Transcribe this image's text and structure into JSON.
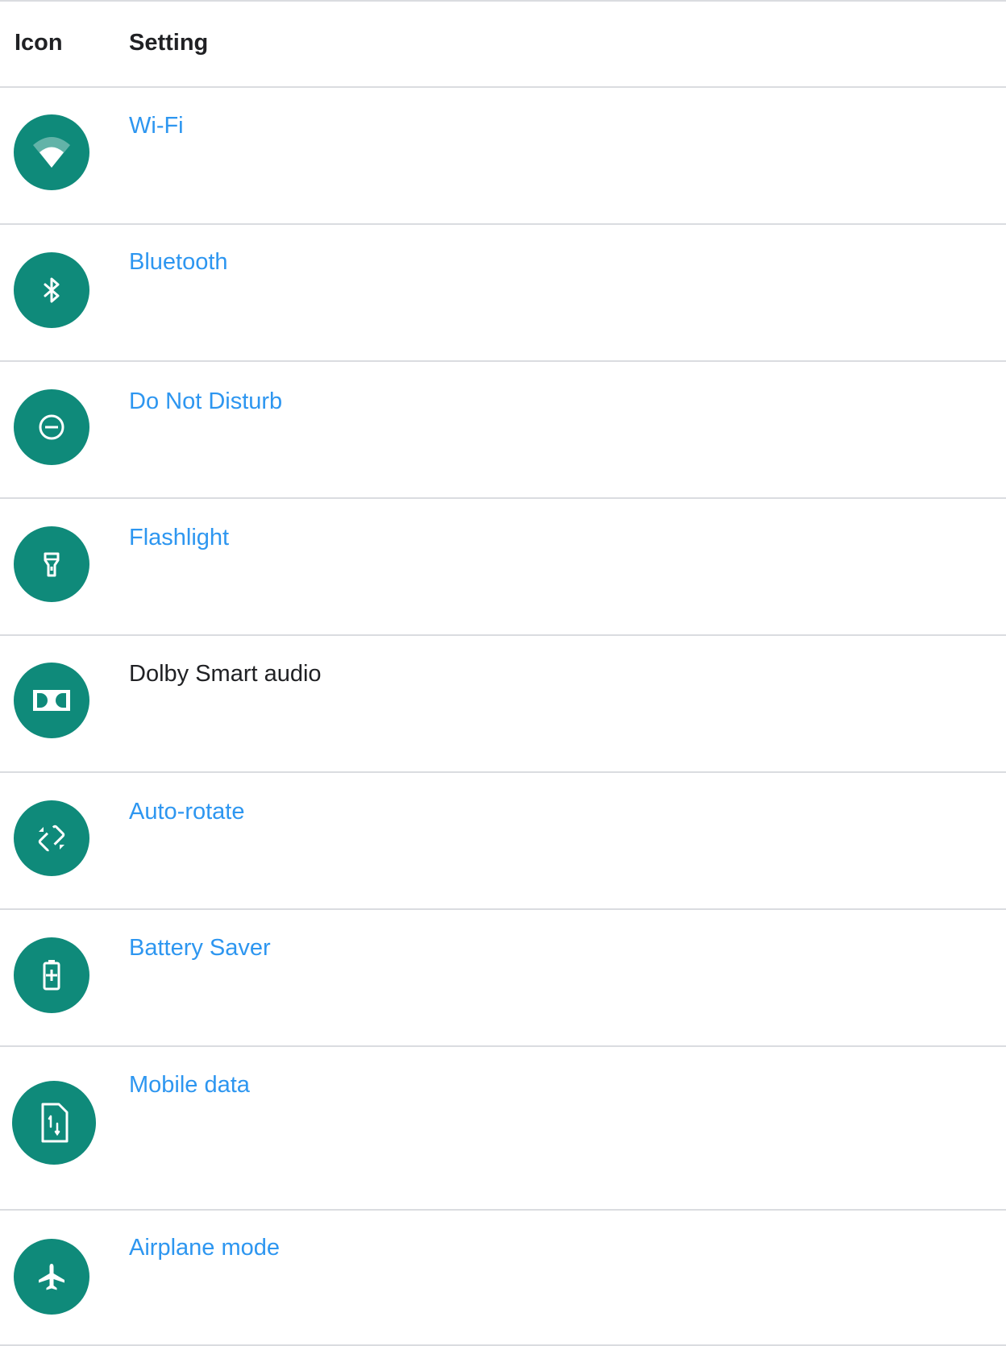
{
  "table": {
    "headers": {
      "icon": "Icon",
      "setting": "Setting"
    },
    "rows": [
      {
        "icon": "wifi-icon",
        "label": "Wi-Fi",
        "is_link": true
      },
      {
        "icon": "bluetooth-icon",
        "label": "Bluetooth",
        "is_link": true
      },
      {
        "icon": "do-not-disturb-icon",
        "label": "Do Not Disturb",
        "is_link": true
      },
      {
        "icon": "flashlight-icon",
        "label": "Flashlight",
        "is_link": true
      },
      {
        "icon": "dolby-icon",
        "label": "Dolby Smart audio",
        "is_link": false
      },
      {
        "icon": "auto-rotate-icon",
        "label": "Auto-rotate",
        "is_link": true
      },
      {
        "icon": "battery-saver-icon",
        "label": "Battery Saver",
        "is_link": true
      },
      {
        "icon": "mobile-data-icon",
        "label": "Mobile data",
        "is_link": true
      },
      {
        "icon": "airplane-icon",
        "label": "Airplane mode",
        "is_link": true
      }
    ]
  },
  "colors": {
    "icon_background": "#0f8a7a",
    "link": "#2d96f0",
    "text": "#202124",
    "divider": "#dadce0"
  }
}
